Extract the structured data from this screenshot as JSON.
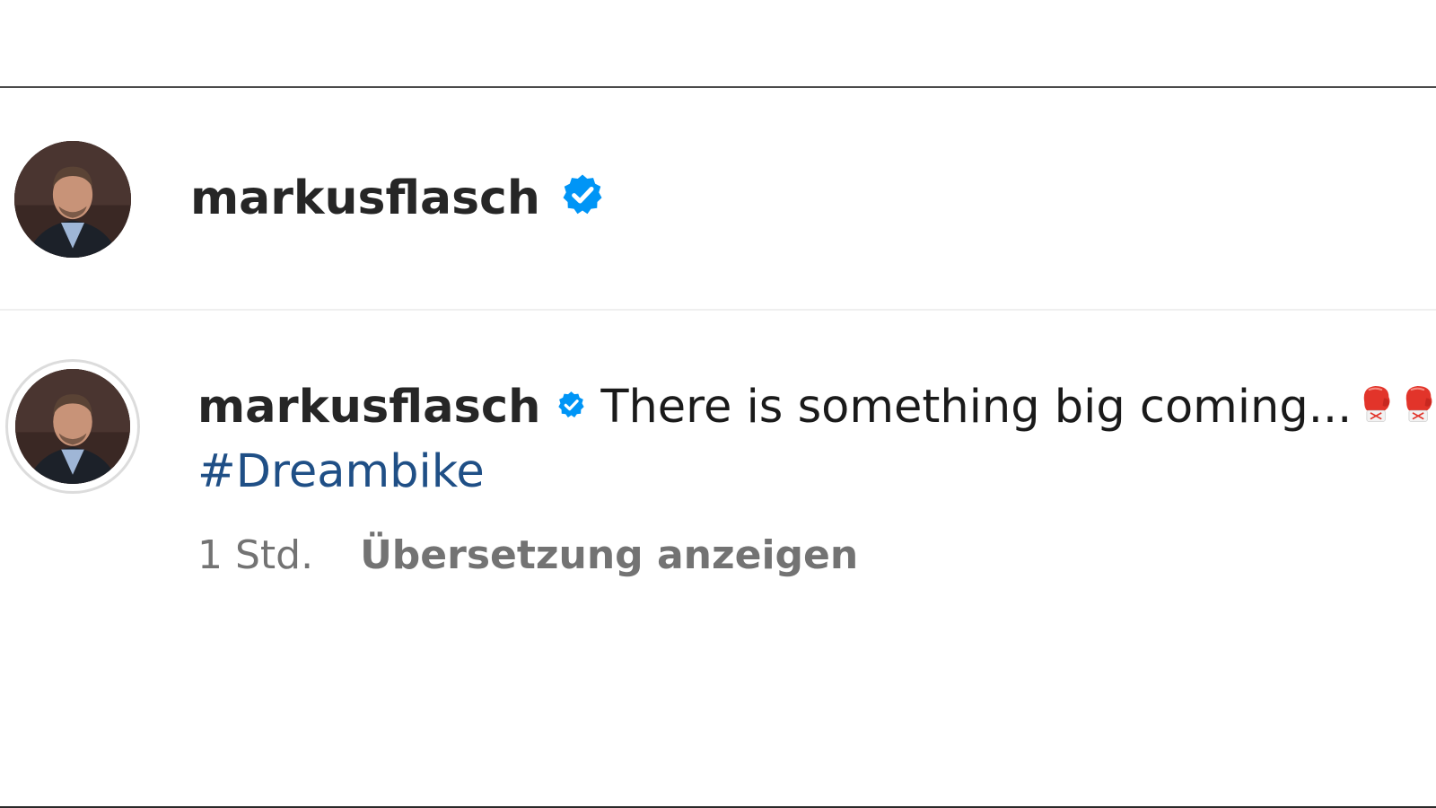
{
  "header": {
    "username": "markusflasch",
    "verified": true
  },
  "comment": {
    "username": "markusflasch",
    "verified": true,
    "text": "There is something big coming...",
    "emoji": [
      "boxing-glove-icon",
      "boxing-glove-icon"
    ],
    "hashtag": "#Dreambike",
    "time": "1 Std.",
    "translate_label": "Übersetzung anzeigen"
  },
  "colors": {
    "verified_badge": "#0095f6",
    "hashtag": "#1f4f86",
    "meta_text": "#737373"
  }
}
